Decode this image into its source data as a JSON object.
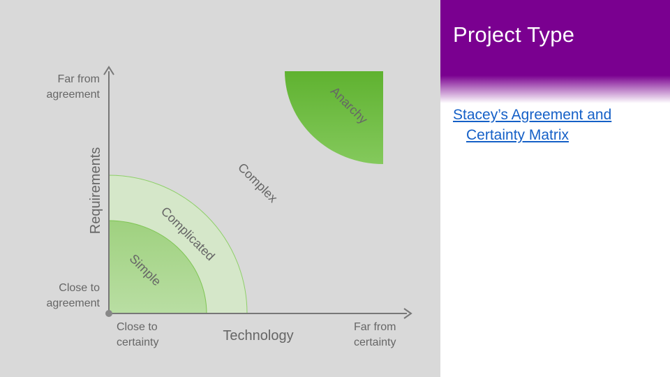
{
  "title": "Project Type",
  "link": {
    "line1": "Stacey’s Agreement and",
    "line2": "Certainty Matrix"
  },
  "axes": {
    "y_label": "Requirements",
    "x_label": "Technology",
    "y_top_line1": "Far from",
    "y_top_line2": "agreement",
    "y_bottom_line1": "Close to",
    "y_bottom_line2": "agreement",
    "x_left_line1": "Close to",
    "x_left_line2": "certainty",
    "x_right_line1": "Far from",
    "x_right_line2": "certainty"
  },
  "regions": {
    "simple": "Simple",
    "complicated": "Complicated",
    "complex": "Complex",
    "anarchy": "Anarchy"
  },
  "colors": {
    "title_bar": "#7a0090",
    "diagram_bg": "#d9d9d9",
    "green": "#6fbe44",
    "link": "#1560c7"
  }
}
